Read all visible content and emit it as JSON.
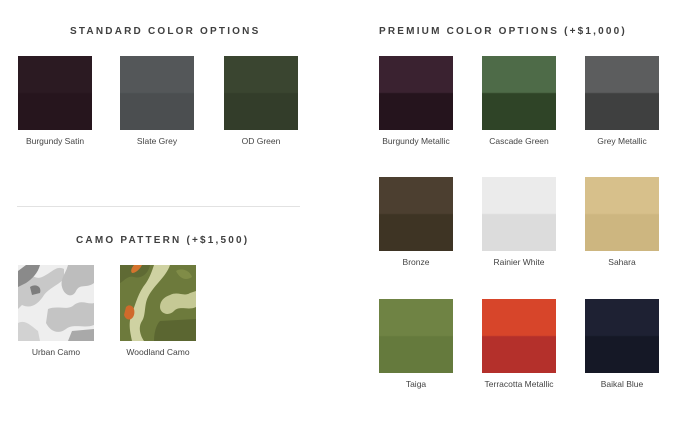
{
  "standard": {
    "title": "STANDARD COLOR OPTIONS",
    "items": [
      {
        "label": "Burgundy Satin",
        "top": "#2b1a22",
        "bottom": "#26151d"
      },
      {
        "label": "Slate Grey",
        "top": "#545759",
        "bottom": "#4b4e50"
      },
      {
        "label": "OD Green",
        "top": "#3a4530",
        "bottom": "#333d2a"
      }
    ]
  },
  "premium": {
    "title": "PREMIUM COLOR OPTIONS (+$1,000)",
    "items": [
      {
        "label": "Burgundy Metallic",
        "top": "#3a2230",
        "bottom": "#25141d"
      },
      {
        "label": "Cascade Green",
        "top": "#4e6b48",
        "bottom": "#2f4427"
      },
      {
        "label": "Grey Metallic",
        "top": "#5c5d5e",
        "bottom": "#3f4040"
      },
      {
        "label": "Bronze",
        "top": "#4c3f30",
        "bottom": "#3e3424"
      },
      {
        "label": "Rainier White",
        "top": "#ebebeb",
        "bottom": "#dcdcdc"
      },
      {
        "label": "Sahara",
        "top": "#d7c08b",
        "bottom": "#cdb680"
      },
      {
        "label": "Taiga",
        "top": "#6f8344",
        "bottom": "#657a3d"
      },
      {
        "label": "Terracotta Metallic",
        "top": "#d7452a",
        "bottom": "#b4302b"
      },
      {
        "label": "Baikal Blue",
        "top": "#1e2133",
        "bottom": "#151826"
      }
    ]
  },
  "camo": {
    "title": "CAMO PATTERN (+$1,500)",
    "items": [
      {
        "label": "Urban Camo"
      },
      {
        "label": "Woodland Camo"
      }
    ]
  }
}
